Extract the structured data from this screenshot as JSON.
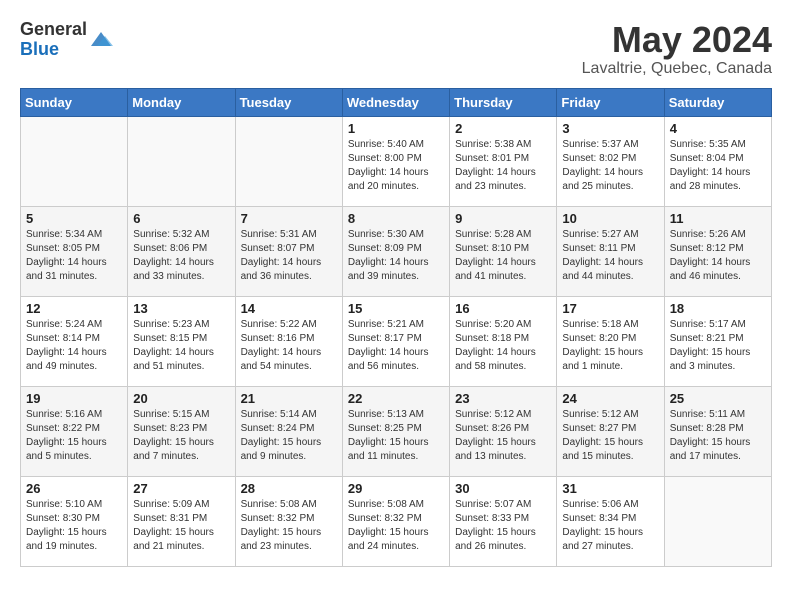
{
  "logo": {
    "general": "General",
    "blue": "Blue"
  },
  "title": "May 2024",
  "subtitle": "Lavaltrie, Quebec, Canada",
  "days_of_week": [
    "Sunday",
    "Monday",
    "Tuesday",
    "Wednesday",
    "Thursday",
    "Friday",
    "Saturday"
  ],
  "weeks": [
    [
      {
        "day": "",
        "info": ""
      },
      {
        "day": "",
        "info": ""
      },
      {
        "day": "",
        "info": ""
      },
      {
        "day": "1",
        "info": "Sunrise: 5:40 AM\nSunset: 8:00 PM\nDaylight: 14 hours\nand 20 minutes."
      },
      {
        "day": "2",
        "info": "Sunrise: 5:38 AM\nSunset: 8:01 PM\nDaylight: 14 hours\nand 23 minutes."
      },
      {
        "day": "3",
        "info": "Sunrise: 5:37 AM\nSunset: 8:02 PM\nDaylight: 14 hours\nand 25 minutes."
      },
      {
        "day": "4",
        "info": "Sunrise: 5:35 AM\nSunset: 8:04 PM\nDaylight: 14 hours\nand 28 minutes."
      }
    ],
    [
      {
        "day": "5",
        "info": "Sunrise: 5:34 AM\nSunset: 8:05 PM\nDaylight: 14 hours\nand 31 minutes."
      },
      {
        "day": "6",
        "info": "Sunrise: 5:32 AM\nSunset: 8:06 PM\nDaylight: 14 hours\nand 33 minutes."
      },
      {
        "day": "7",
        "info": "Sunrise: 5:31 AM\nSunset: 8:07 PM\nDaylight: 14 hours\nand 36 minutes."
      },
      {
        "day": "8",
        "info": "Sunrise: 5:30 AM\nSunset: 8:09 PM\nDaylight: 14 hours\nand 39 minutes."
      },
      {
        "day": "9",
        "info": "Sunrise: 5:28 AM\nSunset: 8:10 PM\nDaylight: 14 hours\nand 41 minutes."
      },
      {
        "day": "10",
        "info": "Sunrise: 5:27 AM\nSunset: 8:11 PM\nDaylight: 14 hours\nand 44 minutes."
      },
      {
        "day": "11",
        "info": "Sunrise: 5:26 AM\nSunset: 8:12 PM\nDaylight: 14 hours\nand 46 minutes."
      }
    ],
    [
      {
        "day": "12",
        "info": "Sunrise: 5:24 AM\nSunset: 8:14 PM\nDaylight: 14 hours\nand 49 minutes."
      },
      {
        "day": "13",
        "info": "Sunrise: 5:23 AM\nSunset: 8:15 PM\nDaylight: 14 hours\nand 51 minutes."
      },
      {
        "day": "14",
        "info": "Sunrise: 5:22 AM\nSunset: 8:16 PM\nDaylight: 14 hours\nand 54 minutes."
      },
      {
        "day": "15",
        "info": "Sunrise: 5:21 AM\nSunset: 8:17 PM\nDaylight: 14 hours\nand 56 minutes."
      },
      {
        "day": "16",
        "info": "Sunrise: 5:20 AM\nSunset: 8:18 PM\nDaylight: 14 hours\nand 58 minutes."
      },
      {
        "day": "17",
        "info": "Sunrise: 5:18 AM\nSunset: 8:20 PM\nDaylight: 15 hours\nand 1 minute."
      },
      {
        "day": "18",
        "info": "Sunrise: 5:17 AM\nSunset: 8:21 PM\nDaylight: 15 hours\nand 3 minutes."
      }
    ],
    [
      {
        "day": "19",
        "info": "Sunrise: 5:16 AM\nSunset: 8:22 PM\nDaylight: 15 hours\nand 5 minutes."
      },
      {
        "day": "20",
        "info": "Sunrise: 5:15 AM\nSunset: 8:23 PM\nDaylight: 15 hours\nand 7 minutes."
      },
      {
        "day": "21",
        "info": "Sunrise: 5:14 AM\nSunset: 8:24 PM\nDaylight: 15 hours\nand 9 minutes."
      },
      {
        "day": "22",
        "info": "Sunrise: 5:13 AM\nSunset: 8:25 PM\nDaylight: 15 hours\nand 11 minutes."
      },
      {
        "day": "23",
        "info": "Sunrise: 5:12 AM\nSunset: 8:26 PM\nDaylight: 15 hours\nand 13 minutes."
      },
      {
        "day": "24",
        "info": "Sunrise: 5:12 AM\nSunset: 8:27 PM\nDaylight: 15 hours\nand 15 minutes."
      },
      {
        "day": "25",
        "info": "Sunrise: 5:11 AM\nSunset: 8:28 PM\nDaylight: 15 hours\nand 17 minutes."
      }
    ],
    [
      {
        "day": "26",
        "info": "Sunrise: 5:10 AM\nSunset: 8:30 PM\nDaylight: 15 hours\nand 19 minutes."
      },
      {
        "day": "27",
        "info": "Sunrise: 5:09 AM\nSunset: 8:31 PM\nDaylight: 15 hours\nand 21 minutes."
      },
      {
        "day": "28",
        "info": "Sunrise: 5:08 AM\nSunset: 8:32 PM\nDaylight: 15 hours\nand 23 minutes."
      },
      {
        "day": "29",
        "info": "Sunrise: 5:08 AM\nSunset: 8:32 PM\nDaylight: 15 hours\nand 24 minutes."
      },
      {
        "day": "30",
        "info": "Sunrise: 5:07 AM\nSunset: 8:33 PM\nDaylight: 15 hours\nand 26 minutes."
      },
      {
        "day": "31",
        "info": "Sunrise: 5:06 AM\nSunset: 8:34 PM\nDaylight: 15 hours\nand 27 minutes."
      },
      {
        "day": "",
        "info": ""
      }
    ]
  ]
}
